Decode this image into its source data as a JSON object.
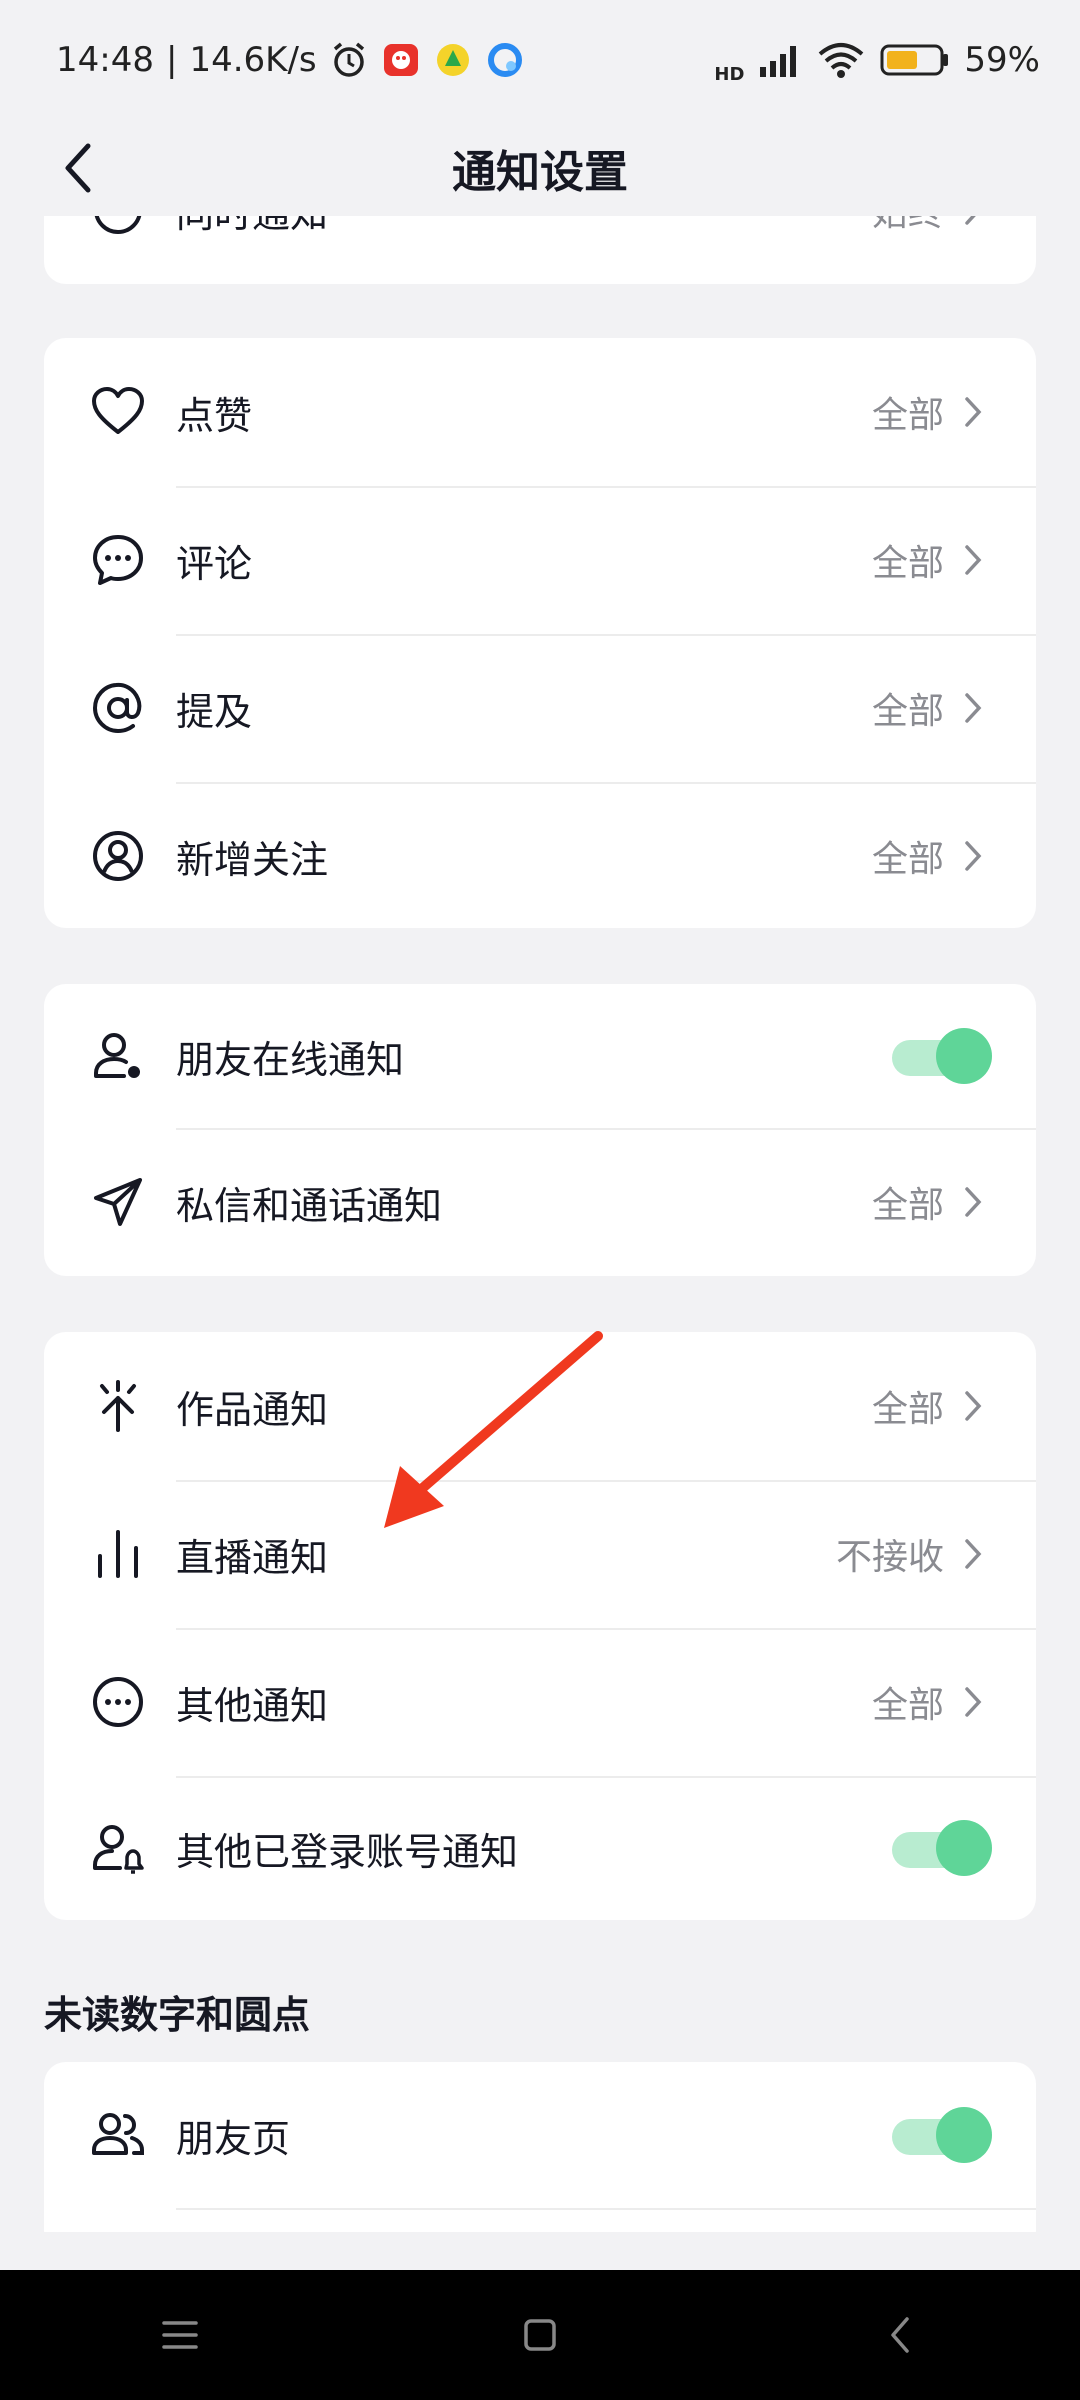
{
  "status_bar": {
    "time": "14:48",
    "speed": "14.6K/s",
    "network": "HD",
    "battery": "59%"
  },
  "nav": {
    "title": "通知设置"
  },
  "card0": {
    "partial_label": "同时通知",
    "partial_value": "始终"
  },
  "card1": {
    "items": [
      {
        "label": "点赞",
        "value": "全部",
        "icon": "heart-icon"
      },
      {
        "label": "评论",
        "value": "全部",
        "icon": "comment-icon"
      },
      {
        "label": "提及",
        "value": "全部",
        "icon": "at-icon"
      },
      {
        "label": "新增关注",
        "value": "全部",
        "icon": "user-circle-icon"
      }
    ]
  },
  "card2": {
    "items": [
      {
        "label": "朋友在线通知",
        "toggle": true,
        "icon": "user-online-icon"
      },
      {
        "label": "私信和通话通知",
        "value": "全部",
        "icon": "send-icon"
      }
    ]
  },
  "card3": {
    "items": [
      {
        "label": "作品通知",
        "value": "全部",
        "icon": "sparkle-icon"
      },
      {
        "label": "直播通知",
        "value": "不接收",
        "icon": "live-bars-icon"
      },
      {
        "label": "其他通知",
        "value": "全部",
        "icon": "more-circle-icon"
      },
      {
        "label": "其他已登录账号通知",
        "toggle": true,
        "icon": "user-bell-icon"
      }
    ]
  },
  "section_unread": {
    "title": "未读数字和圆点"
  },
  "card4": {
    "items": [
      {
        "label": "朋友页",
        "toggle": true,
        "icon": "friends-icon"
      }
    ]
  },
  "colors": {
    "toggle_on": "#5fd598",
    "toggle_track": "#b8ecd0",
    "annotation_arrow": "#f0391f"
  }
}
